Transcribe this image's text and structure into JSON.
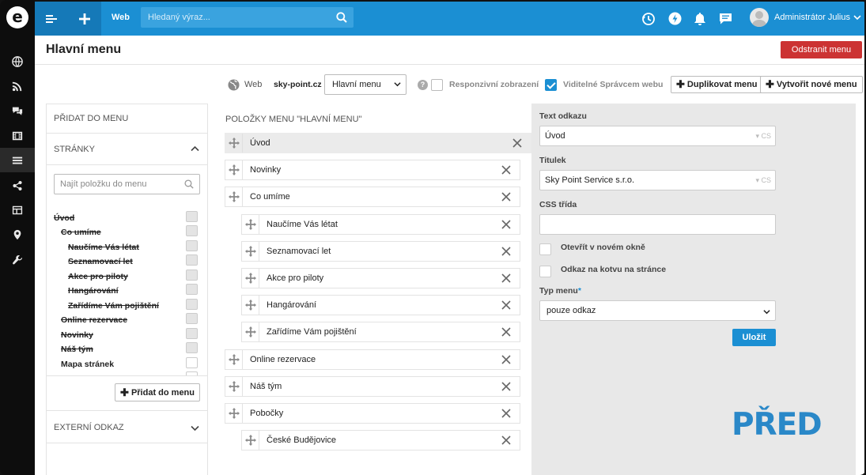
{
  "topbar": {
    "logo": "e",
    "web_label": "Web",
    "search_placeholder": "Hledaný výraz...",
    "user_name": "Administrátor Julius"
  },
  "page": {
    "title": "Hlavní menu",
    "delete_button": "Odstranit menu"
  },
  "toolbar": {
    "web_label": "Web",
    "site": "sky-point.cz",
    "menu_select": "Hlavní menu",
    "help_icon": "?",
    "responsive_label": "Responzivní zobrazení",
    "responsive_checked": false,
    "visible_label": "Viditelné Správcem webu",
    "visible_checked": true,
    "duplicate_button": "Duplikovat menu",
    "create_button": "Vytvořit nové menu"
  },
  "left": {
    "add_to_menu": "PŘIDAT DO MENU",
    "pages_header": "STRÁNKY",
    "search_placeholder": "Najít položku do menu",
    "tree": [
      {
        "label": "Úvod",
        "level": 0,
        "strike": true,
        "checked_bg": true
      },
      {
        "label": "Co umíme",
        "level": 1,
        "strike": true,
        "checked_bg": true
      },
      {
        "label": "Naučíme Vás létat",
        "level": 2,
        "strike": true,
        "checked_bg": true
      },
      {
        "label": "Seznamovací let",
        "level": 2,
        "strike": true,
        "checked_bg": true
      },
      {
        "label": "Akce pro piloty",
        "level": 2,
        "strike": true,
        "checked_bg": true
      },
      {
        "label": "Hangárování",
        "level": 2,
        "strike": true,
        "checked_bg": true
      },
      {
        "label": "Zařídíme Vám pojištění",
        "level": 2,
        "strike": true,
        "checked_bg": true
      },
      {
        "label": "Online rezervace",
        "level": 1,
        "strike": true,
        "checked_bg": true
      },
      {
        "label": "Novinky",
        "level": 1,
        "strike": true,
        "checked_bg": true
      },
      {
        "label": "Náš tým",
        "level": 1,
        "strike": true,
        "checked_bg": true
      },
      {
        "label": "Mapa stránek",
        "level": 1,
        "strike": false,
        "checked_bg": false
      }
    ],
    "add_button": "Přidat do menu",
    "external_header": "EXTERNÍ ODKAZ"
  },
  "center": {
    "title": "POLOŽKY MENU \"HLAVNÍ MENU\"",
    "items": [
      {
        "label": "Úvod",
        "level": 0,
        "selected": true
      },
      {
        "label": "Novinky",
        "level": 0,
        "selected": false
      },
      {
        "label": "Co umíme",
        "level": 0,
        "selected": false
      },
      {
        "label": "Naučíme Vás létat",
        "level": 1,
        "selected": false
      },
      {
        "label": "Seznamovací let",
        "level": 1,
        "selected": false
      },
      {
        "label": "Akce pro piloty",
        "level": 1,
        "selected": false
      },
      {
        "label": "Hangárování",
        "level": 1,
        "selected": false
      },
      {
        "label": "Zařídíme Vám pojištění",
        "level": 1,
        "selected": false
      },
      {
        "label": "Online rezervace",
        "level": 0,
        "selected": false
      },
      {
        "label": "Náš tým",
        "level": 0,
        "selected": false
      },
      {
        "label": "Pobočky",
        "level": 0,
        "selected": false
      },
      {
        "label": "České Budějovice",
        "level": 1,
        "selected": false
      }
    ]
  },
  "right": {
    "link_text_label": "Text odkazu",
    "link_text_value": "Úvod",
    "title_label": "Titulek",
    "title_value": "Sky Point Service s.r.o.",
    "lang_badge": "CS",
    "css_label": "CSS třída",
    "css_value": "",
    "new_window_label": "Otevřít v novém okně",
    "anchor_label": "Odkaz na kotvu na stránce",
    "type_label": "Typ menu",
    "required_mark": "*",
    "type_value": "pouze odkaz",
    "save_button": "Uložit",
    "watermark": "PŘED"
  },
  "colors": {
    "accent": "#1b8fd3",
    "danger": "#cc3333",
    "watermark": "#2a88c8"
  }
}
